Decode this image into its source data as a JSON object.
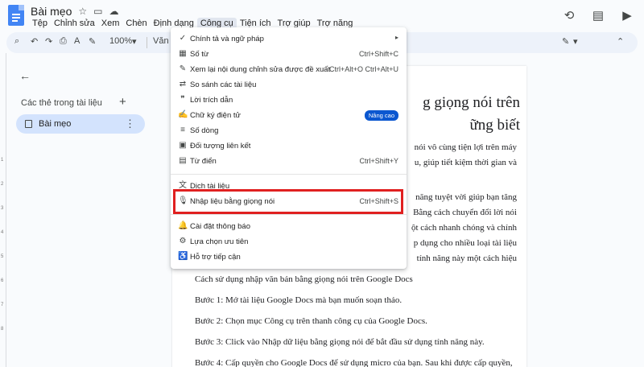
{
  "header": {
    "doc_title": "Bài mẹo",
    "menus": [
      "Tệp",
      "Chỉnh sửa",
      "Xem",
      "Chèn",
      "Định dạng",
      "Công cụ",
      "Tiện ích",
      "Trợ giúp",
      "Trợ năng"
    ],
    "active_menu": "Công cụ"
  },
  "toolbar": {
    "zoom": "100%",
    "style_partial": "Văn b"
  },
  "sidebar": {
    "tabs_heading": "Các thẻ trong tài liệu",
    "tab_label": "Bài mẹo"
  },
  "tools_menu": {
    "items": [
      {
        "label": "Chính tả và ngữ pháp",
        "icon": "spellcheck-icon"
      },
      {
        "label": "Số từ",
        "shortcut": "Ctrl+Shift+C",
        "icon": "word-count-icon"
      },
      {
        "label": "Xem lại nội dung chỉnh sửa được đề xuất",
        "shortcut": "Ctrl+Alt+O Ctrl+Alt+U",
        "icon": "review-edits-icon"
      },
      {
        "label": "So sánh các tài liệu",
        "icon": "compare-icon"
      },
      {
        "label": "Lời trích dẫn",
        "icon": "quote-icon"
      },
      {
        "label": "Chữ ký điện tử",
        "badge": "Nâng cao",
        "icon": "signature-icon"
      },
      {
        "label": "Số dòng",
        "icon": "line-numbers-icon"
      },
      {
        "label": "Đối tượng liên kết",
        "icon": "linked-objects-icon"
      },
      {
        "label": "Từ điển",
        "shortcut": "Ctrl+Shift+Y",
        "icon": "dictionary-icon"
      },
      {
        "label": "Dịch tài liệu",
        "icon": "translate-icon"
      },
      {
        "label": "Nhập liệu bằng giọng nói",
        "shortcut": "Ctrl+Shift+S",
        "icon": "microphone-icon"
      },
      {
        "label": "Cài đặt thông báo",
        "icon": "bell-icon"
      },
      {
        "label": "Lựa chọn ưu tiên",
        "icon": "preferences-icon"
      },
      {
        "label": "Hỗ trợ tiếp cận",
        "icon": "accessibility-icon"
      }
    ]
  },
  "document": {
    "heading_line1": "g giọng nói trên",
    "heading_line2": "ững biết",
    "para1_line1": "nói vô cùng tiện lợi trên máy",
    "para1_line2": "u, giúp tiết kiệm thời gian và",
    "para2_lines": [
      "năng tuyệt vời giúp bạn tăng",
      "Bằng cách chuyển đổi lời nói",
      "ột cách nhanh chóng và chính",
      "p dụng cho nhiều loại tài liệu",
      "tính năng này một cách hiệu"
    ],
    "lines": [
      "Cách sử dụng nhập văn bản bằng giọng nói trên Google Docs",
      "Bước 1: Mở tài liệu Google Docs mà bạn muốn soạn thảo.",
      "Bước 2: Chọn mục Công cụ trên thanh công cụ của Google Docs.",
      "Bước 3: Click vào Nhập dữ liệu bằng giọng nói để bắt đầu sử dụng tính năng này.",
      "Bước 4: Cấp quyền cho Google Docs để sử dụng micro của bạn. Sau khi được cấp quyền,"
    ]
  },
  "colors": {
    "accent": "#0b57d0",
    "highlight": "#e02020",
    "active_tab": "#d3e3fd"
  }
}
